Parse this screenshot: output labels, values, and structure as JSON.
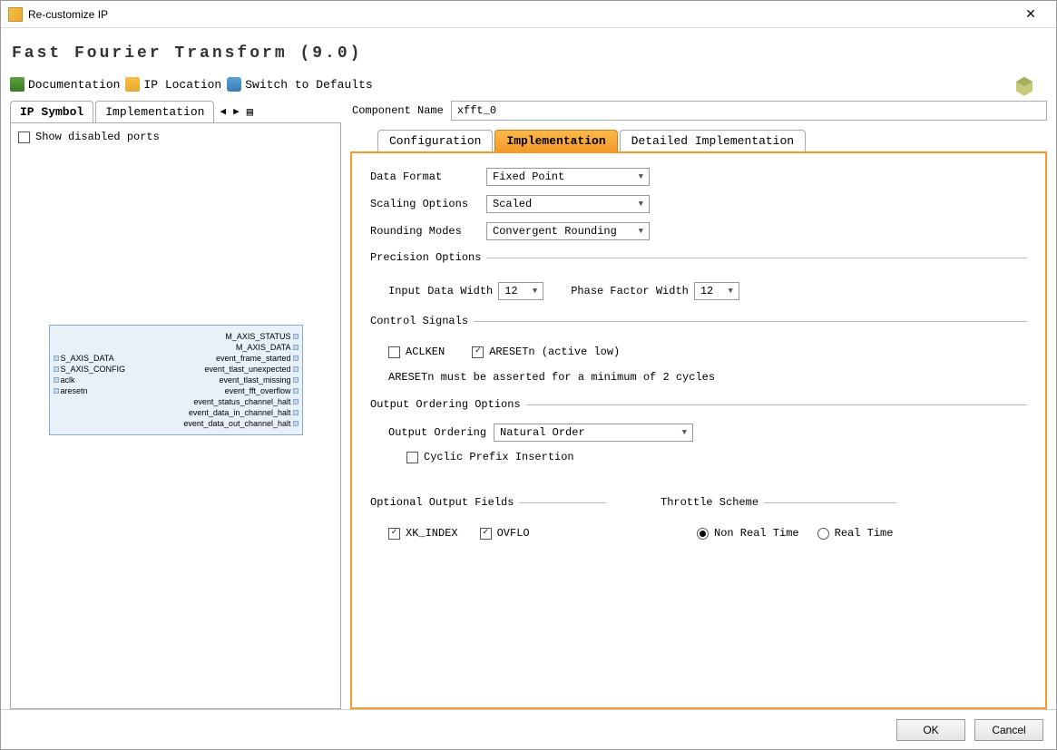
{
  "window": {
    "title": "Re-customize IP"
  },
  "header": {
    "title": "Fast Fourier Transform (9.0)"
  },
  "toolbar": {
    "documentation": "Documentation",
    "ip_location": "IP Location",
    "switch_defaults": "Switch to Defaults"
  },
  "left": {
    "tabs": {
      "ip_symbol": "IP Symbol",
      "implementation": "Implementation"
    },
    "show_disabled": "Show disabled ports",
    "ports_left": [
      "S_AXIS_DATA",
      "S_AXIS_CONFIG",
      "aclk",
      "aresetn"
    ],
    "ports_right": [
      "M_AXIS_STATUS",
      "M_AXIS_DATA",
      "event_frame_started",
      "event_tlast_unexpected",
      "event_tlast_missing",
      "event_fft_overflow",
      "event_status_channel_halt",
      "event_data_in_channel_halt",
      "event_data_out_channel_halt"
    ]
  },
  "component": {
    "label": "Component Name",
    "value": "xfft_0"
  },
  "right_tabs": {
    "configuration": "Configuration",
    "implementation": "Implementation",
    "detailed": "Detailed Implementation"
  },
  "form": {
    "data_format": {
      "label": "Data Format",
      "value": "Fixed Point"
    },
    "scaling": {
      "label": "Scaling Options",
      "value": "Scaled"
    },
    "rounding": {
      "label": "Rounding Modes",
      "value": "Convergent Rounding"
    },
    "precision": {
      "legend": "Precision Options",
      "input_width": {
        "label": "Input Data Width",
        "value": "12"
      },
      "phase_width": {
        "label": "Phase Factor Width",
        "value": "12"
      }
    },
    "control": {
      "legend": "Control Signals",
      "aclken": "ACLKEN",
      "aresetn": "ARESETn (active low)",
      "note": "ARESETn must be asserted for a minimum of 2 cycles"
    },
    "output_ordering": {
      "legend": "Output Ordering Options",
      "label": "Output Ordering",
      "value": "Natural Order",
      "cyclic": "Cyclic Prefix Insertion"
    },
    "optional_fields": {
      "legend": "Optional Output Fields",
      "xk_index": "XK_INDEX",
      "ovflo": "OVFLO"
    },
    "throttle": {
      "legend": "Throttle Scheme",
      "non_realtime": "Non Real Time",
      "realtime": "Real Time"
    }
  },
  "footer": {
    "ok": "OK",
    "cancel": "Cancel"
  }
}
